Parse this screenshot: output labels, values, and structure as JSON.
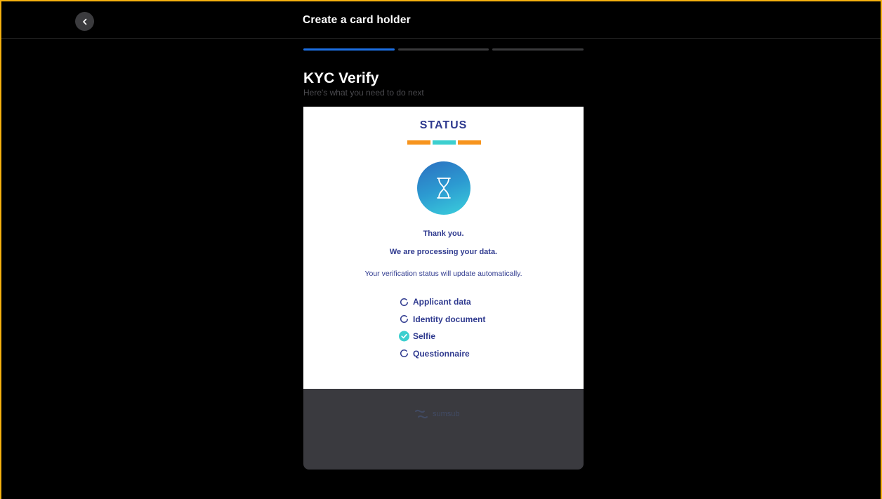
{
  "header": {
    "title": "Create a card holder",
    "back_icon": "chevron-left-icon"
  },
  "progress": {
    "steps": 3,
    "current": 1,
    "active_color": "#1c6fe3",
    "inactive_color": "#3a3a3c"
  },
  "page": {
    "heading": "KYC Verify",
    "subheading": "Here's what you need to do next"
  },
  "status_card": {
    "title": "STATUS",
    "bar_colors": [
      "#f7941d",
      "#3ccfcf",
      "#f7941d"
    ],
    "icon": "hourglass-icon",
    "thank_you": "Thank you.",
    "processing": "We are processing your data.",
    "auto_update": "Your verification status will update automatically.",
    "items": [
      {
        "label": "Applicant data",
        "state": "pending",
        "icon": "pending-circle-icon"
      },
      {
        "label": "Identity document",
        "state": "pending",
        "icon": "pending-circle-icon"
      },
      {
        "label": "Selfie",
        "state": "done",
        "icon": "check-circle-icon"
      },
      {
        "label": "Questionnaire",
        "state": "pending",
        "icon": "pending-circle-icon"
      }
    ],
    "footer_logo": "sumsub"
  },
  "colors": {
    "accent_border": "#f5b10f",
    "text_navy": "#2f3a8f",
    "check_teal": "#3ccfcf"
  }
}
